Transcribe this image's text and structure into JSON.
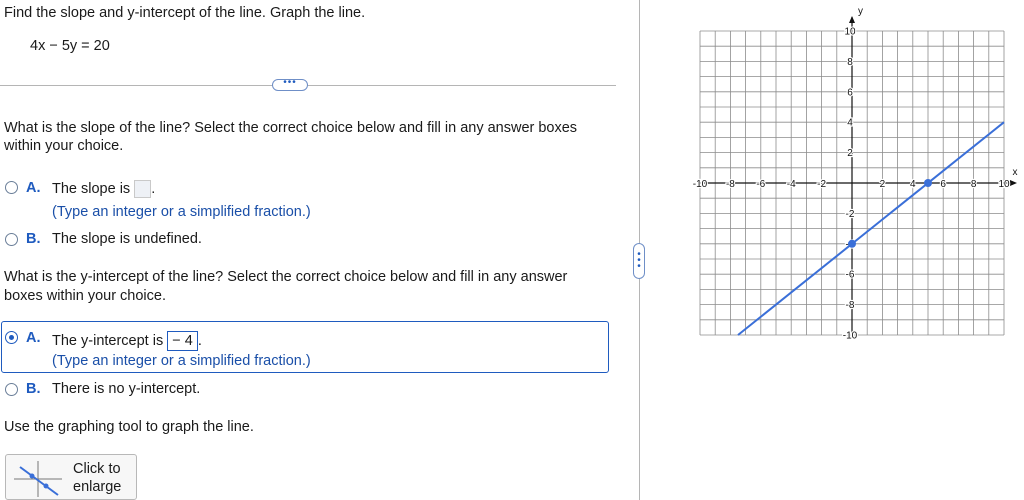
{
  "question": {
    "instruction": "Find the slope and y-intercept of the line. Graph the line.",
    "equation": "4x − 5y = 20"
  },
  "expand_dots": "•••",
  "slope_part": {
    "prompt_line1": "What is the slope of the line? Select the correct choice below and fill in any answer boxes",
    "prompt_line2": "within your choice.",
    "option_a": {
      "letter": "A.",
      "text": "The slope is",
      "answer": "",
      "after": ".",
      "hint": "(Type an integer or a simplified fraction.)"
    },
    "option_b": {
      "letter": "B.",
      "text": "The slope is undefined."
    }
  },
  "intercept_part": {
    "prompt_line1": "What is the y-intercept of the line? Select the correct choice below and fill in any answer",
    "prompt_line2": "boxes within your choice.",
    "option_a": {
      "letter": "A.",
      "text": "The y-intercept is",
      "answer": "− 4",
      "after": ".",
      "hint": "(Type an integer or a simplified fraction.)",
      "selected": true
    },
    "option_b": {
      "letter": "B.",
      "text": "There is no y-intercept."
    }
  },
  "graph_instruction": "Use the graphing tool to graph the line.",
  "enlarge_button": {
    "line1": "Click to",
    "line2": "enlarge"
  },
  "graph": {
    "x_axis_label": "x",
    "y_axis_label": "y",
    "x_range": [
      -10,
      10
    ],
    "y_range": [
      -10,
      10
    ],
    "grid": true,
    "x_tick_labels": [
      "-10",
      "-8",
      "-6",
      "-4",
      "-2",
      "2",
      "4",
      "6",
      "8",
      "10"
    ],
    "y_tick_labels": [
      "10",
      "8",
      "6",
      "4",
      "2",
      "-2",
      "-4",
      "-6",
      "-8",
      "-10"
    ],
    "line_color": "#3a6fd8",
    "line": {
      "slope": 0.8,
      "intercept": -4
    },
    "points": [
      {
        "x": 0,
        "y": -4
      },
      {
        "x": 5,
        "y": 0
      }
    ]
  },
  "colors": {
    "accent": "#1f5bbf",
    "divider": "#b5b5b5",
    "grid": "#8c8c8c"
  }
}
